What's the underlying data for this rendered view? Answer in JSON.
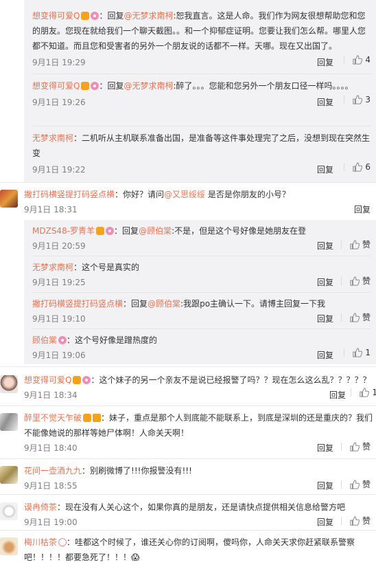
{
  "thread": {
    "reply_label": "回复",
    "like_label": "赞",
    "sub": [
      {
        "user": "想变得可爱Q",
        "badges": [
          "vip",
          "donut"
        ],
        "prefix": "：回复",
        "mention": "@无梦求南柯",
        "text": ":恕我直言。这是人命。我们作为网友很想帮助您和您的朋友。您现在就给我们一个聊天截图。。和一个抑郁症证明。您要让我们怎么帮。哪里人您都不知道。而且您和受害者的另外一个朋友说的话都不一样。天哪。现在又出国了。",
        "time": "9月1日 19:29",
        "likes": "4"
      },
      {
        "user": "想变得可爱Q",
        "badges": [
          "vip",
          "donut"
        ],
        "prefix": "：回复",
        "mention": "@无梦求南柯",
        "text": ":醉了。。。您能和您另外一个朋友口径一样吗。。。。",
        "time": "9月1日 19:26",
        "likes": "3"
      },
      {
        "user": "无梦求南柯",
        "badges": [],
        "prefix": "",
        "mention": "",
        "text": "：二机听从主机联系准备出国，是准备等这件事处理完了之后，没想到现在突然生变",
        "time": "9月1日 19:22",
        "likes": "6"
      }
    ],
    "second": {
      "user": "撇打码横竖提打码竖点横",
      "text_pre": "：你好？请问",
      "mention": "@又思绥绥",
      "text_post": " 是否是你朋友的小号？",
      "time": "9月1日 18:31",
      "replies": [
        {
          "user": "MDZS48-罗青羊",
          "badges": [
            "vip",
            "donut"
          ],
          "prefix": "：回复",
          "mention": "@顾伯棠",
          "text": ":不是，但是这个号好像是她朋友在登",
          "time": "9月1日 20:59",
          "likes": "赞"
        },
        {
          "user": "无梦求南柯",
          "badges": [],
          "prefix": "",
          "mention": "",
          "text": "：这个号是真实的",
          "time": "9月1日 19:25",
          "likes": "赞"
        },
        {
          "user": "撇打码横竖提打码竖点横",
          "badges": [],
          "prefix": "：回复",
          "mention": "@顾伯棠",
          "text": ":我跟po主确认一下。请博主回复一下我",
          "time": "9月1日 19:10",
          "likes": "赞"
        },
        {
          "user": "顾伯棠",
          "badges": [
            "donut"
          ],
          "prefix": "",
          "mention": "",
          "text": "：这个号好像是蹭热度的",
          "time": "9月1日 19:06",
          "likes": "1"
        }
      ]
    },
    "top": [
      {
        "user": "想变得可爱Q",
        "badges": [
          "vip",
          "donut"
        ],
        "text": "：这个妹子的另一个亲友不是说已经报警了吗？？现在怎么这么乱？？？？？",
        "time": "9月1日 18:34",
        "likes": "1"
      },
      {
        "user": "醉里不觉天乍破",
        "badges": [
          "vip",
          "cup"
        ],
        "text": "：妹子，重点是那个人到底能不能联系上，到底是深圳的还是重庆的？我们不能像她说的那样等她尸体啊！人命关天啊！",
        "time": "9月1日 18:40",
        "likes": "赞"
      },
      {
        "user": "花间一壶酒九九",
        "badges": [],
        "text": "：别刷微博了!!!你报警没有!!!",
        "time": "9月1日 18:55",
        "likes": "赞"
      },
      {
        "user": "谟冉倚茶",
        "badges": [],
        "text": "：现在没有人关心这个，如果你真的是朋友，还是请快点提供相关信息给警方吧",
        "time": "9月1日 19:00",
        "likes": "赞"
      },
      {
        "user": "梅川枯茶",
        "badges": [
          "rabbit"
        ],
        "text": "：哇都这个时候了，谁还关心你的订阅啊，傻吗你，人命关天求你赶紧联系警察吧！！！！都要急死了！！！😱",
        "time": "",
        "likes": ""
      }
    ]
  }
}
